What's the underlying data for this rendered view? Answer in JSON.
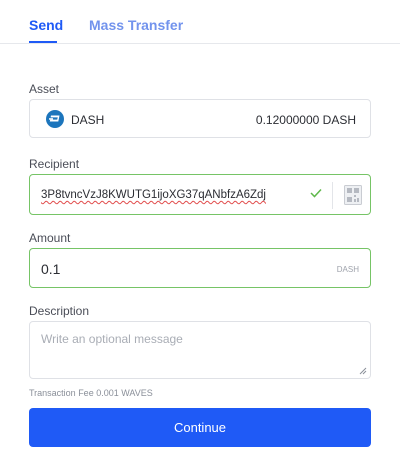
{
  "tabs": {
    "send": "Send",
    "mass_transfer": "Mass Transfer",
    "active": "send"
  },
  "asset": {
    "label": "Asset",
    "name": "DASH",
    "balance": "0.12000000 DASH",
    "icon": "dash-icon"
  },
  "recipient": {
    "label": "Recipient",
    "value": "3P8tvncVzJ8KWUTG1ijoXG37qANbfzA6Zdj",
    "valid": true
  },
  "amount": {
    "label": "Amount",
    "value": "0.1",
    "unit": "DASH"
  },
  "description": {
    "label": "Description",
    "placeholder": "Write an optional message",
    "value": ""
  },
  "fee": {
    "text": "Transaction Fee 0.001 WAVES"
  },
  "continue_button": {
    "label": "Continue"
  },
  "colors": {
    "accent": "#1f5af6",
    "valid_border": "#76c466",
    "dash_brand": "#1c75bc"
  }
}
